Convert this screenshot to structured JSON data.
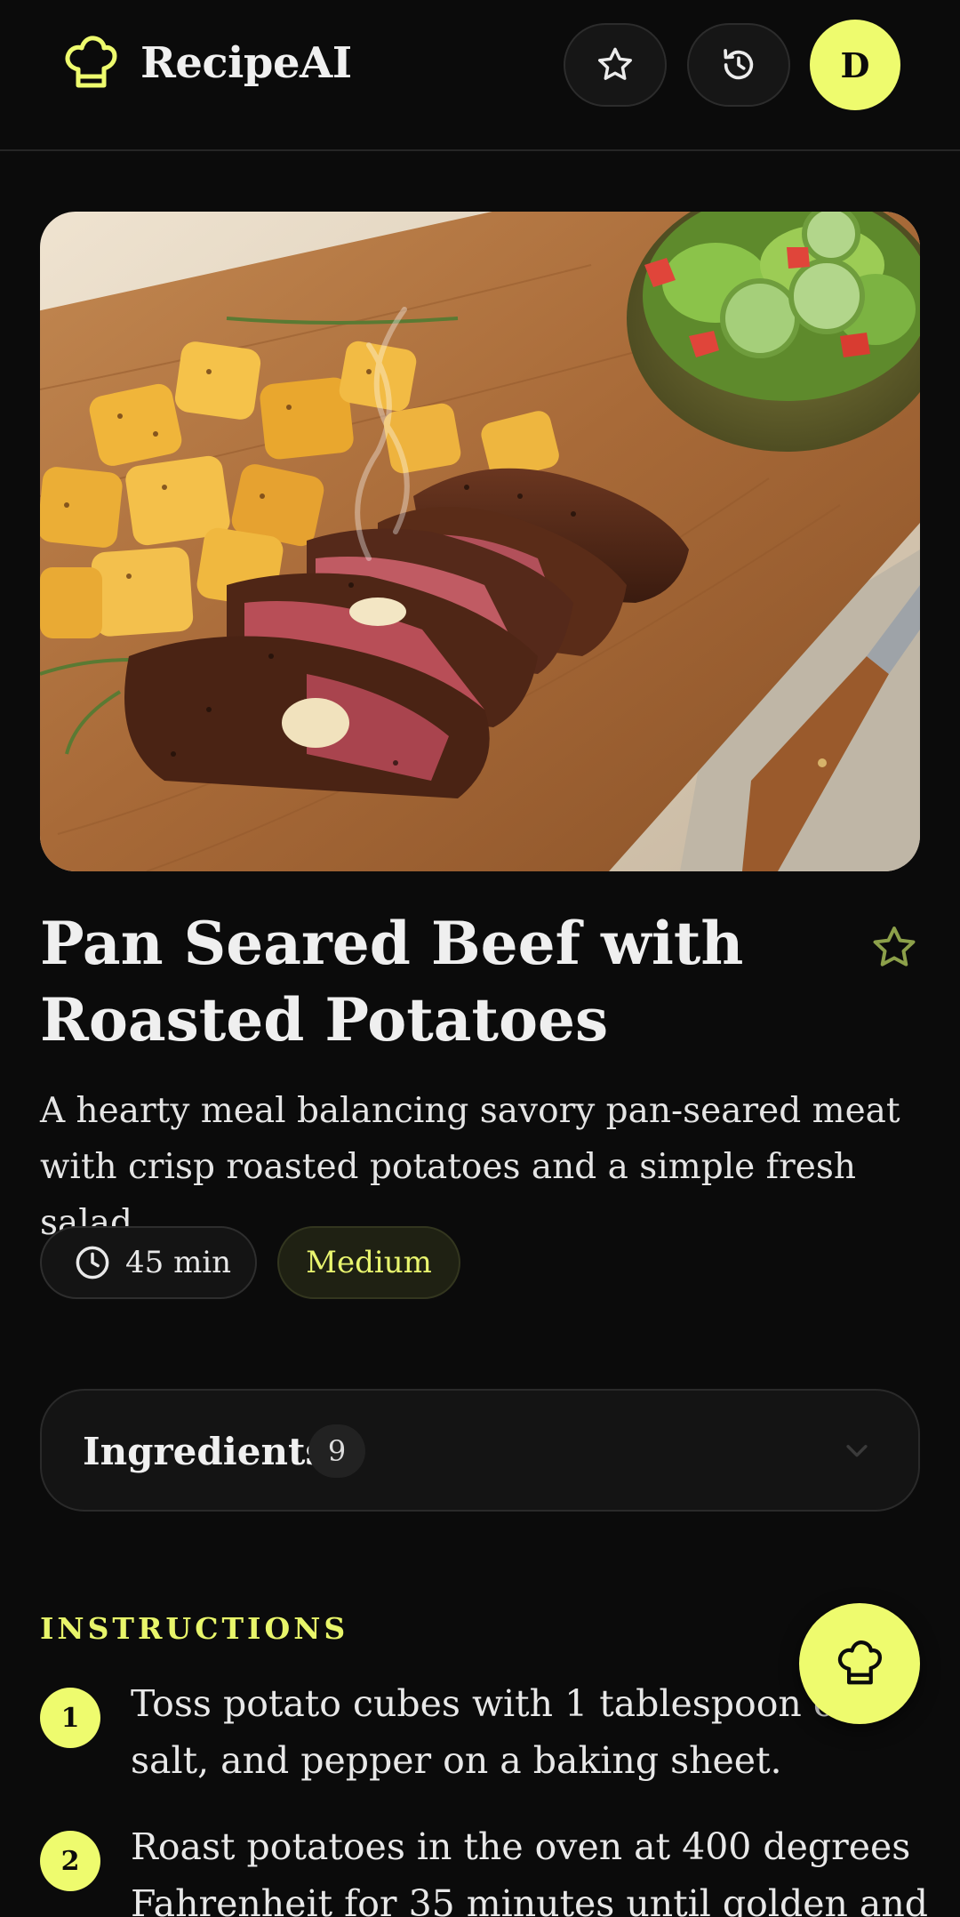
{
  "app": {
    "name": "RecipeAI",
    "avatar_initial": "D"
  },
  "header_icons": [
    "chef-hat-icon",
    "star-icon",
    "history-icon"
  ],
  "recipe": {
    "title": "Pan Seared Beef with Roasted Potatoes",
    "description": "A hearty meal balancing savory pan-seared meat with crisp roasted potatoes and a simple fresh salad.",
    "time": "45 min",
    "difficulty": "Medium",
    "favorited": false
  },
  "ingredients": {
    "label": "Ingredients",
    "count": "9",
    "expanded": false
  },
  "instructions": {
    "heading": "INSTRUCTIONS",
    "steps": [
      {
        "number": "1",
        "text": "Toss potato cubes with 1 tablespoon oil, salt, and pepper on a baking sheet."
      },
      {
        "number": "2",
        "text": "Roast potatoes in the oven at 400 degrees Fahrenheit for 35 minutes until golden and"
      }
    ]
  },
  "colors": {
    "background": "#0b0b0b",
    "accent": "#eefb6e",
    "surface": "#141414",
    "text": "#ececec"
  }
}
